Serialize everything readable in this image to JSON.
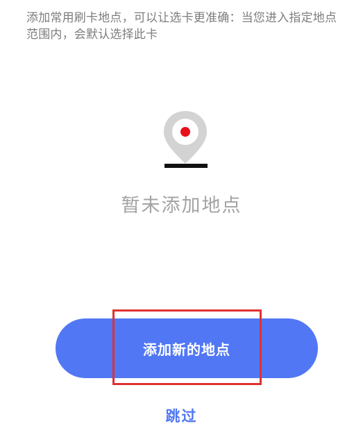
{
  "hint": {
    "text": "添加常用刷卡地点，可以让选卡更准确：当您进入指定地点范围内，会默认选择此卡"
  },
  "empty_state": {
    "icon": "location-pin-icon",
    "text": "暂未添加地点"
  },
  "actions": {
    "add_location_label": "添加新的地点",
    "skip_label": "跳过"
  },
  "colors": {
    "accent": "#5177f4",
    "pin_dot": "#e8101a",
    "pin_body": "#d3d3d3",
    "highlight": "#e03131"
  }
}
